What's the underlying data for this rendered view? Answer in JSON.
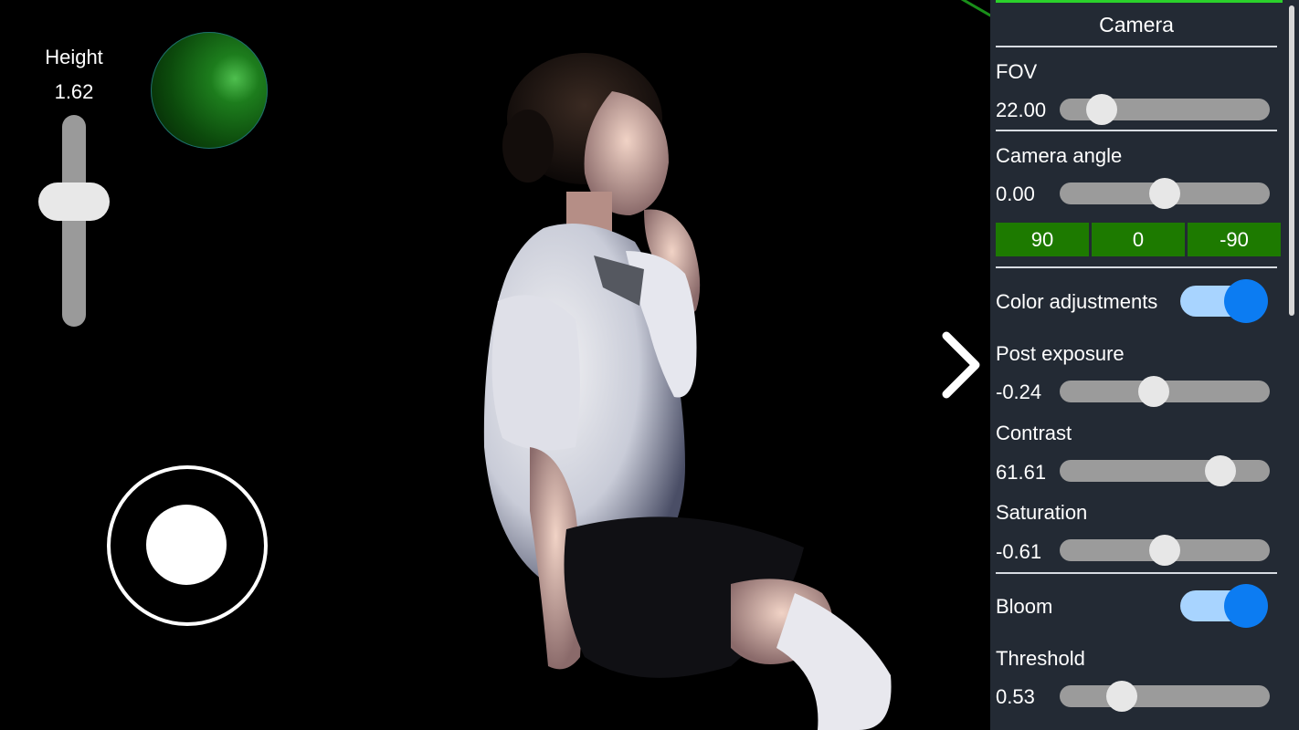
{
  "left_controls": {
    "height_label": "Height",
    "height_value": "1.62"
  },
  "panel": {
    "title": "Camera",
    "fov": {
      "label": "FOV",
      "value": "22.00",
      "level": 0.15
    },
    "camera_angle": {
      "label": "Camera angle",
      "value": "0.00",
      "level": 0.5
    },
    "angle_buttons": [
      "90",
      "0",
      "-90"
    ],
    "color_adjustments": {
      "label": "Color adjustments",
      "enabled": true
    },
    "post_exposure": {
      "label": "Post exposure",
      "value": "-0.24",
      "level": 0.44
    },
    "contrast": {
      "label": "Contrast",
      "value": "61.61",
      "level": 0.81
    },
    "saturation": {
      "label": "Saturation",
      "value": "-0.61",
      "level": 0.5
    },
    "bloom": {
      "label": "Bloom",
      "enabled": true
    },
    "threshold": {
      "label": "Threshold",
      "value": "0.53",
      "level": 0.26
    }
  },
  "colors": {
    "panel_bg": "#232a34",
    "accent_green": "#1d7a00",
    "toggle_blue": "#0c7cf2"
  },
  "icons": {
    "expand": "chevron-right-icon"
  }
}
